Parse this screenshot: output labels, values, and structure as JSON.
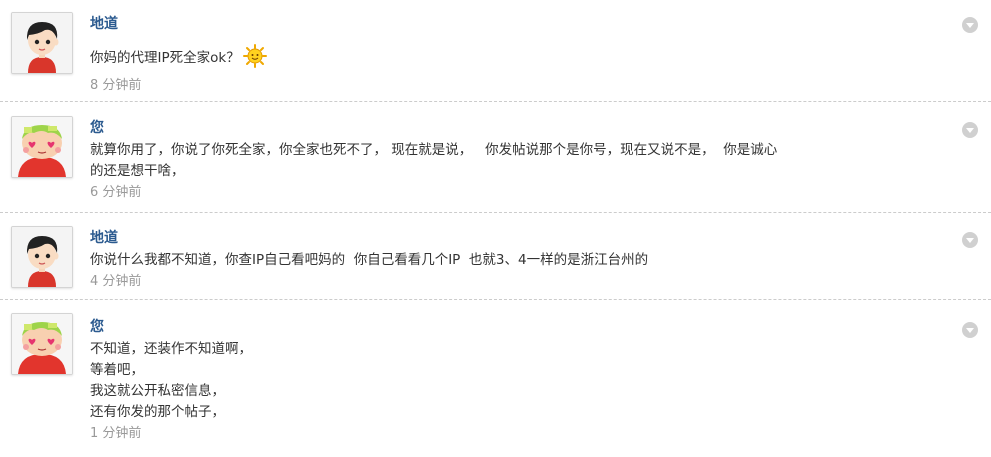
{
  "comments": [
    {
      "author": "地道",
      "avatar": "boy-avatar-icon",
      "lines": [
        "你妈的代理IP死全家ok？"
      ],
      "emoji": "sun-emoji-icon",
      "time": "8 分钟前"
    },
    {
      "author": "您",
      "avatar": "cartoon-girl-avatar-icon",
      "lines": [
        "就算你用了，你说了你死全家，你全家也死不了， 现在就是说，   你发帖说那个是你号，现在又说不是，  你是诚心",
        "的还是想干啥，"
      ],
      "time": "6 分钟前"
    },
    {
      "author": "地道",
      "avatar": "boy-avatar-icon",
      "lines": [
        "你说什么我都不知道，你查IP自己看吧妈的  你自己看看几个IP  也就3、4一样的是浙江台州的"
      ],
      "time": "4 分钟前"
    },
    {
      "author": "您",
      "avatar": "cartoon-girl-avatar-icon",
      "lines": [
        "不知道，还装作不知道啊，",
        "等着吧，",
        "我这就公开私密信息，",
        "还有你发的那个帖子，"
      ],
      "time": "1 分钟前"
    }
  ],
  "colors": {
    "author_link": "#2b5a8f",
    "time_text": "#999999",
    "divider": "#cccccc",
    "menu_toggle": "#d0d0d0"
  }
}
